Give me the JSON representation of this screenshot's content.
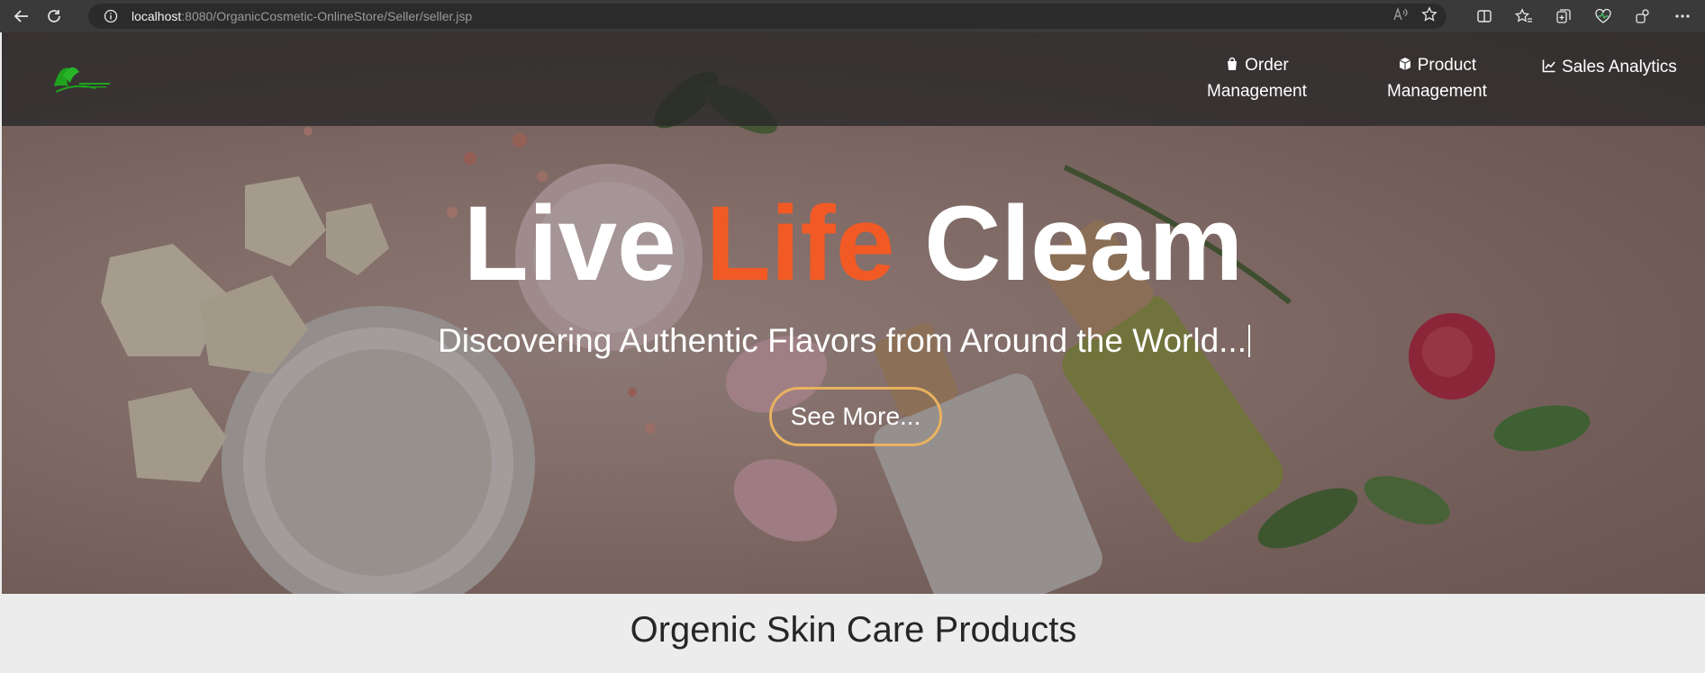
{
  "browser": {
    "url_host": "localhost",
    "url_rest": ":8080/OrganicCosmetic-OnlineStore/Seller/seller.jsp"
  },
  "nav": {
    "order_line1": "Order",
    "order_line2": "Management",
    "product_line1": "Product",
    "product_line2": "Management",
    "analytics": "Sales Analytics"
  },
  "hero": {
    "headline_part1": "Live",
    "headline_accent": "Life",
    "headline_part3": "Cleam",
    "subtitle": "Discovering Authentic Flavors from Around the World...",
    "cta_label": "See More..."
  },
  "section": {
    "title": "Orgenic Skin Care Products"
  },
  "colors": {
    "accent": "#f15a24",
    "button_border": "#e9b25f",
    "logo_green": "#1fa31f"
  }
}
